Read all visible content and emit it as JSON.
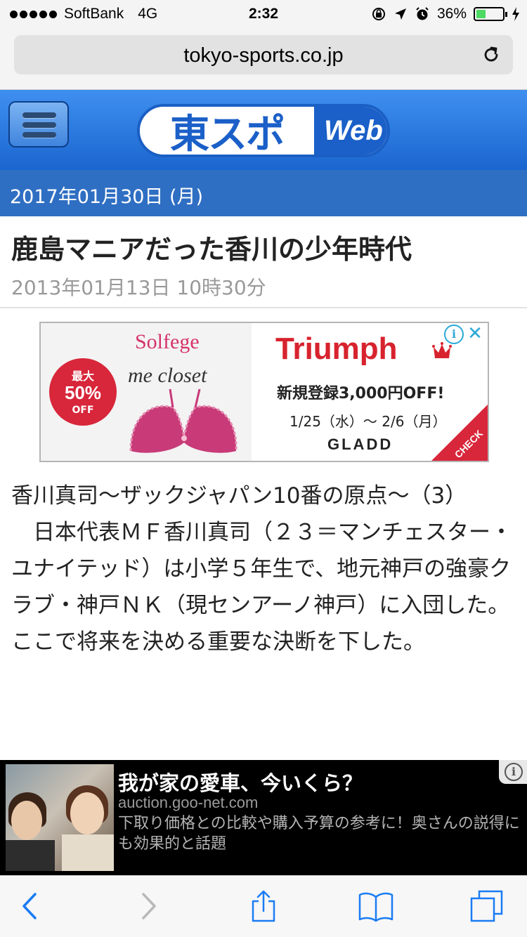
{
  "status_bar": {
    "carrier": "SoftBank",
    "network": "4G",
    "time": "2:32",
    "battery_percent": "36%",
    "battery_level": 0.36
  },
  "browser": {
    "url": "tokyo-sports.co.jp"
  },
  "site": {
    "logo_text": "東スポ",
    "logo_suffix": "Web",
    "date": "2017年01月30日 (月)"
  },
  "article": {
    "title": "鹿島マニアだった香川の少年時代",
    "published": "2013年01月13日 10時30分",
    "body": [
      "香川真司〜ザックジャパン10番の原点〜（3）",
      "　日本代表ＭＦ香川真司（２３＝マンチェスター・ユナイテッド）は小学５年生で、地元神戸の強豪クラブ・神戸ＮＫ（現センアーノ神戸）に入団した。ここで将来を決める重要な決断を下した。"
    ]
  },
  "ad_banner": {
    "brand1": "Solfege",
    "brand2": "me closet",
    "badge_top": "最大",
    "badge_value": "50%",
    "badge_bottom": "OFF",
    "headline": "Triumph",
    "offer": "新規登録3,000円OFF!",
    "period": "1/25（水）〜 2/6（月）",
    "store": "GLADD",
    "cta": "CHECK",
    "brand_color": "#d7232e"
  },
  "bottom_ad": {
    "title": "我が家の愛車、今いくら？",
    "domain": "auction.goo-net.com",
    "description": "下取り価格との比較や購入予算の参考に！奥さんの説得にも効果的と話題"
  },
  "toolbar": {
    "icons": [
      "back-icon",
      "forward-icon",
      "share-icon",
      "bookmarks-icon",
      "tabs-icon"
    ]
  },
  "colors": {
    "header_blue": "#2a7ae0",
    "date_bar": "#2f6fc3",
    "ios_blue": "#1a7cf4"
  }
}
